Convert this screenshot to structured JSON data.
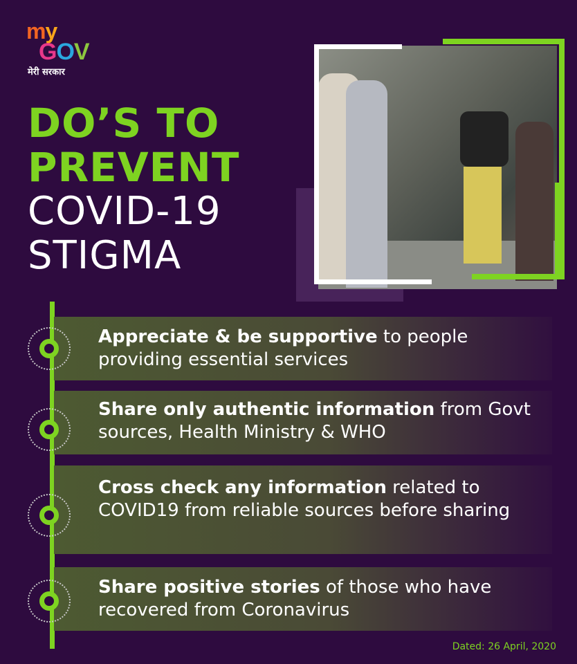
{
  "logo": {
    "my_m": "m",
    "my_y": "y",
    "gov_g": "G",
    "gov_o": "O",
    "gov_v": "V",
    "tagline": "मेरी सरकार"
  },
  "title": {
    "line1": "DO’S TO",
    "line2": "PREVENT",
    "line3": "COVID-19",
    "line4": "STIGMA"
  },
  "items": [
    {
      "bold": "Appreciate & be supportive",
      "rest": " to people providing essential services"
    },
    {
      "bold": "Share only authentic information",
      "rest": " from Govt sources, Health Ministry & WHO"
    },
    {
      "bold": "Cross check any information",
      "rest": " related to COVID19 from reliable sources before sharing"
    },
    {
      "bold": "Share positive stories",
      "rest": " of those who have recovered from Coronavirus"
    }
  ],
  "date": "Dated: 26 April, 2020",
  "colors": {
    "accent_green": "#7ed321",
    "background": "#2e0b3f"
  }
}
